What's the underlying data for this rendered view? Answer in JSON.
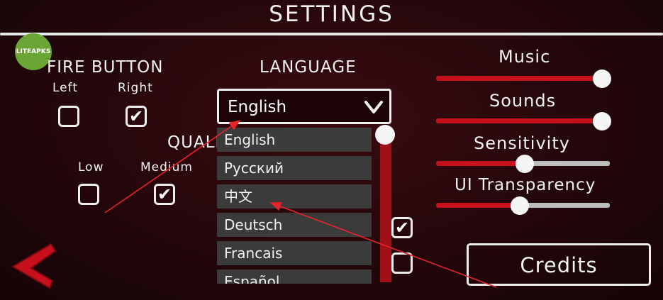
{
  "header": {
    "title": "SETTINGS"
  },
  "watermark": {
    "text": "LITEAPKS"
  },
  "fire_button": {
    "title": "FIRE BUTTON",
    "left_label": "Left",
    "right_label": "Right",
    "left_checked": false,
    "right_checked": true
  },
  "quality": {
    "title": "QUALI",
    "low_label": "Low",
    "medium_label": "Medium",
    "low_checked": false,
    "medium_checked": true
  },
  "language": {
    "title": "LANGUAGE",
    "selected": "English",
    "options": [
      "English",
      "Русский",
      "中文",
      "Deutsch",
      "Francais",
      "Español"
    ]
  },
  "sliders": {
    "music": {
      "label": "Music",
      "value": 1.0
    },
    "sounds": {
      "label": "Sounds",
      "value": 1.0
    },
    "sensitivity": {
      "label": "Sensitivity",
      "value": 0.53
    },
    "ui_transparency": {
      "label": "UI Transparency",
      "value": 0.5
    }
  },
  "hidden_checkboxes": {
    "first_checked": true,
    "second_checked": false
  },
  "credits": {
    "label": "Credits"
  },
  "colors": {
    "accent_red": "#c8101c",
    "slider_grey": "#bdbdbd",
    "option_bg": "#3b3b3b",
    "watermark_green": "#6aa535"
  }
}
